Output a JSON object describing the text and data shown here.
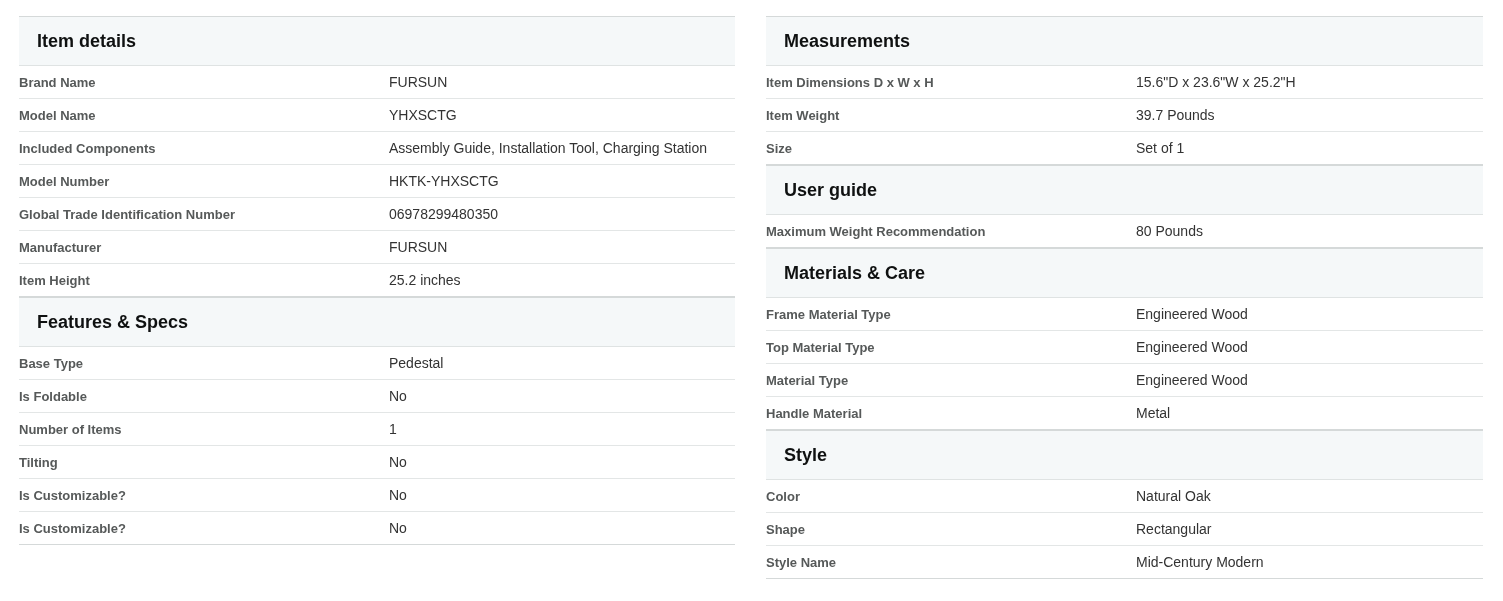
{
  "columns": [
    {
      "sections": [
        {
          "title": "Item details",
          "rows": [
            {
              "label": "Brand Name",
              "value": "FURSUN"
            },
            {
              "label": "Model Name",
              "value": "YHXSCTG"
            },
            {
              "label": "Included Components",
              "value": "Assembly Guide, Installation Tool, Charging Station"
            },
            {
              "label": "Model Number",
              "value": "HKTK-YHXSCTG"
            },
            {
              "label": "Global Trade Identification Number",
              "value": "06978299480350"
            },
            {
              "label": "Manufacturer",
              "value": "FURSUN"
            },
            {
              "label": "Item Height",
              "value": "25.2 inches"
            }
          ]
        },
        {
          "title": "Features & Specs",
          "rows": [
            {
              "label": "Base Type",
              "value": "Pedestal"
            },
            {
              "label": "Is Foldable",
              "value": "No"
            },
            {
              "label": "Number of Items",
              "value": "1"
            },
            {
              "label": "Tilting",
              "value": "No"
            },
            {
              "label": "Is Customizable?",
              "value": "No"
            },
            {
              "label": "Is Customizable?",
              "value": "No"
            }
          ]
        }
      ]
    },
    {
      "sections": [
        {
          "title": "Measurements",
          "rows": [
            {
              "label": "Item Dimensions D x W x H",
              "value": "15.6\"D x 23.6\"W x 25.2\"H"
            },
            {
              "label": "Item Weight",
              "value": "39.7 Pounds"
            },
            {
              "label": "Size",
              "value": "Set of 1"
            }
          ]
        },
        {
          "title": "User guide",
          "rows": [
            {
              "label": "Maximum Weight Recommendation",
              "value": "80 Pounds"
            }
          ]
        },
        {
          "title": "Materials & Care",
          "rows": [
            {
              "label": "Frame Material Type",
              "value": "Engineered Wood"
            },
            {
              "label": "Top Material Type",
              "value": "Engineered Wood"
            },
            {
              "label": "Material Type",
              "value": "Engineered Wood"
            },
            {
              "label": "Handle Material",
              "value": "Metal"
            }
          ]
        },
        {
          "title": "Style",
          "rows": [
            {
              "label": "Color",
              "value": "Natural Oak"
            },
            {
              "label": "Shape",
              "value": "Rectangular"
            },
            {
              "label": "Style Name",
              "value": "Mid-Century Modern"
            }
          ]
        }
      ]
    }
  ]
}
